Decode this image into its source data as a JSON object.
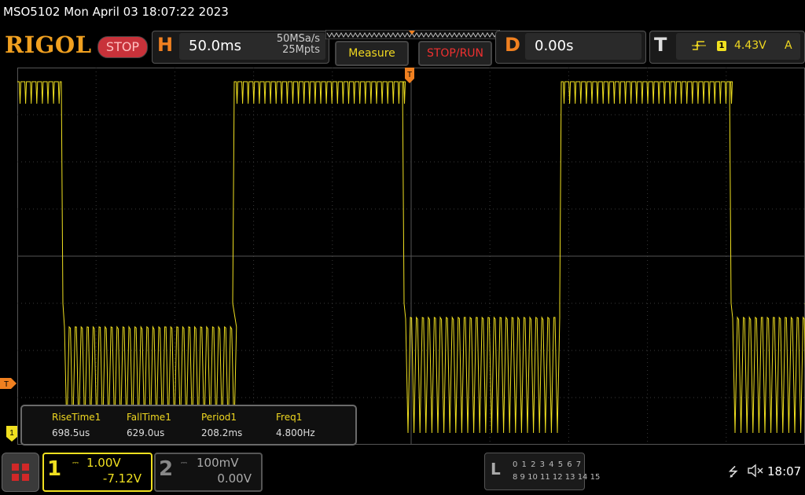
{
  "title_bar": {
    "text": "MSO5102  Mon April 03 18:07:22 2023"
  },
  "brand": {
    "logo": "RIGOL",
    "run_state": "STOP"
  },
  "horizontal": {
    "letter": "H",
    "timebase": "50.0ms",
    "sample_rate": "50MSa/s",
    "memory_depth": "25Mpts"
  },
  "buttons": {
    "measure": "Measure",
    "stop_run": "STOP/RUN"
  },
  "delay": {
    "letter": "D",
    "value": "0.00s"
  },
  "trigger": {
    "letter": "T",
    "edge_icon": "rising-edge-icon",
    "source": "1",
    "level": "4.43V",
    "mode": "A"
  },
  "markers": {
    "trigger_level": "T",
    "ch1_ground": "1",
    "trigger_position": "T"
  },
  "measurements": {
    "headers": [
      "RiseTime1",
      "FallTime1",
      "Period1",
      "Freq1"
    ],
    "values": [
      "698.5us",
      "629.0us",
      "208.2ms",
      "4.800Hz"
    ]
  },
  "channel1": {
    "number": "1",
    "scale": "1.00V",
    "offset": "-7.12V"
  },
  "channel2": {
    "number": "2",
    "scale": "100mV",
    "offset": "0.00V"
  },
  "logic": {
    "letter": "L",
    "row1": "0 1 2 3  4 5 6 7",
    "row2": "8 9 10 11 12 13 14 15"
  },
  "status": {
    "usb_icon": "usb-icon",
    "sound_icon": "muted-speaker-icon",
    "time": "18:07"
  },
  "colors": {
    "ch1": "#f0e020",
    "accent": "#f08020",
    "stop": "#c8323a",
    "grid": "#3a3a3a"
  }
}
